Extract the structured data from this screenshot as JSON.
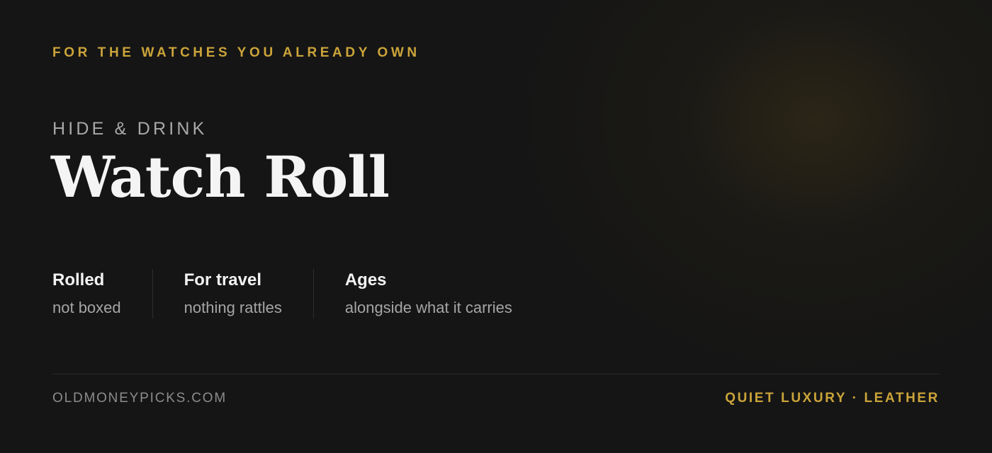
{
  "eyebrow": "FOR THE WATCHES YOU ALREADY OWN",
  "brand": "HIDE & DRINK",
  "title": "Watch Roll",
  "features": [
    {
      "title": "Rolled",
      "subtitle": "not boxed"
    },
    {
      "title": "For travel",
      "subtitle": "nothing rattles"
    },
    {
      "title": "Ages",
      "subtitle": "alongside what it carries"
    }
  ],
  "footer": {
    "domain": "OLDMONEYPICKS.COM",
    "tagline": "QUIET LUXURY · LEATHER"
  },
  "colors": {
    "background": "#151515",
    "accent_gold": "#cba43a",
    "title_text": "#f4f4f4",
    "muted_text": "#a5a5a5"
  }
}
